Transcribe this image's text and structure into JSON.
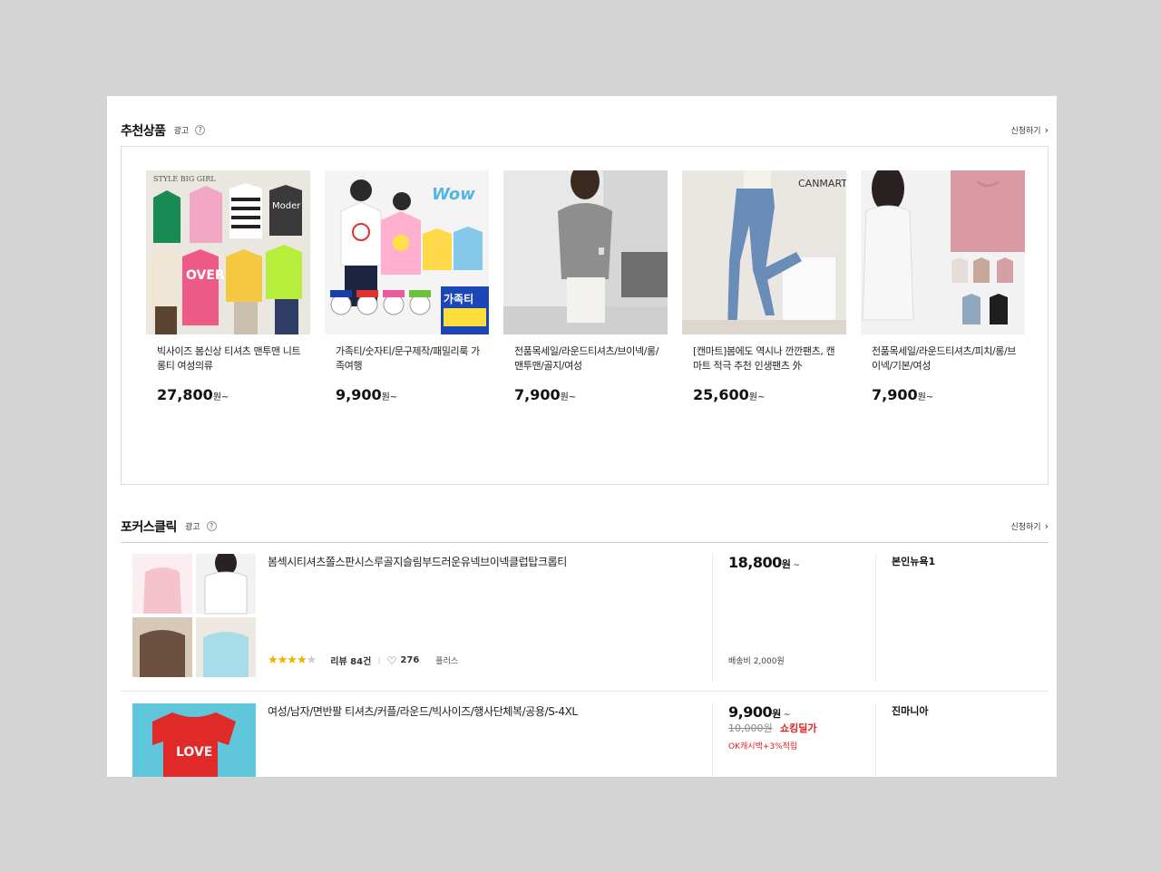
{
  "recommend": {
    "title": "추천상품",
    "ad": "광고",
    "help": "?",
    "apply": "신청하기",
    "items": [
      {
        "name": "빅사이즈 봄신상 티셔츠 맨투맨 니트 롱티 여성의류",
        "price": "27,800",
        "unit": "원~",
        "image_text": "STYLE BIG GIRL"
      },
      {
        "name": "가족티/숫자티/문구제작/패밀리룩 가족여행",
        "price": "9,900",
        "unit": "원~",
        "image_text": "가족티"
      },
      {
        "name": "전품목세일/라운드티셔츠/브이넥/롱/맨투맨/골지/여성",
        "price": "7,900",
        "unit": "원~",
        "image_text": ""
      },
      {
        "name": "[캔마트]봄에도 역시나 깐깐팬츠, 캔마트 적극 추천 인생팬츠 外",
        "price": "25,600",
        "unit": "원~",
        "image_text": "CANMART"
      },
      {
        "name": "전품목세일/라운드티셔츠/피치/롱/브이넥/기본/여성",
        "price": "7,900",
        "unit": "원~",
        "image_text": ""
      }
    ]
  },
  "focus": {
    "title": "포커스클릭",
    "ad": "광고",
    "help": "?",
    "apply": "신청하기",
    "rows": [
      {
        "name": "봄섹시티셔츠쫄스판시스루골지슬림부드러운유넥브이넥클럽탑크롭티",
        "price": "18,800",
        "unit": "원",
        "tilde": "~",
        "rating": 3.5,
        "review": "리뷰 84건",
        "likes": "276",
        "plus": "플러스",
        "shipping": "배송비 2,000원",
        "seller": "본인뉴욕1"
      },
      {
        "name": "여성/남자/면반팔 티셔츠/커플/라운드/빅사이즈/행사단체복/공용/S-4XL",
        "price": "9,900",
        "unit": "원",
        "tilde": "~",
        "old_price": "10,000원",
        "sale": "쇼킹딜가",
        "cash": "OK캐시백+3%적립",
        "seller": "진마니아",
        "image_text": "LOVE"
      }
    ]
  }
}
